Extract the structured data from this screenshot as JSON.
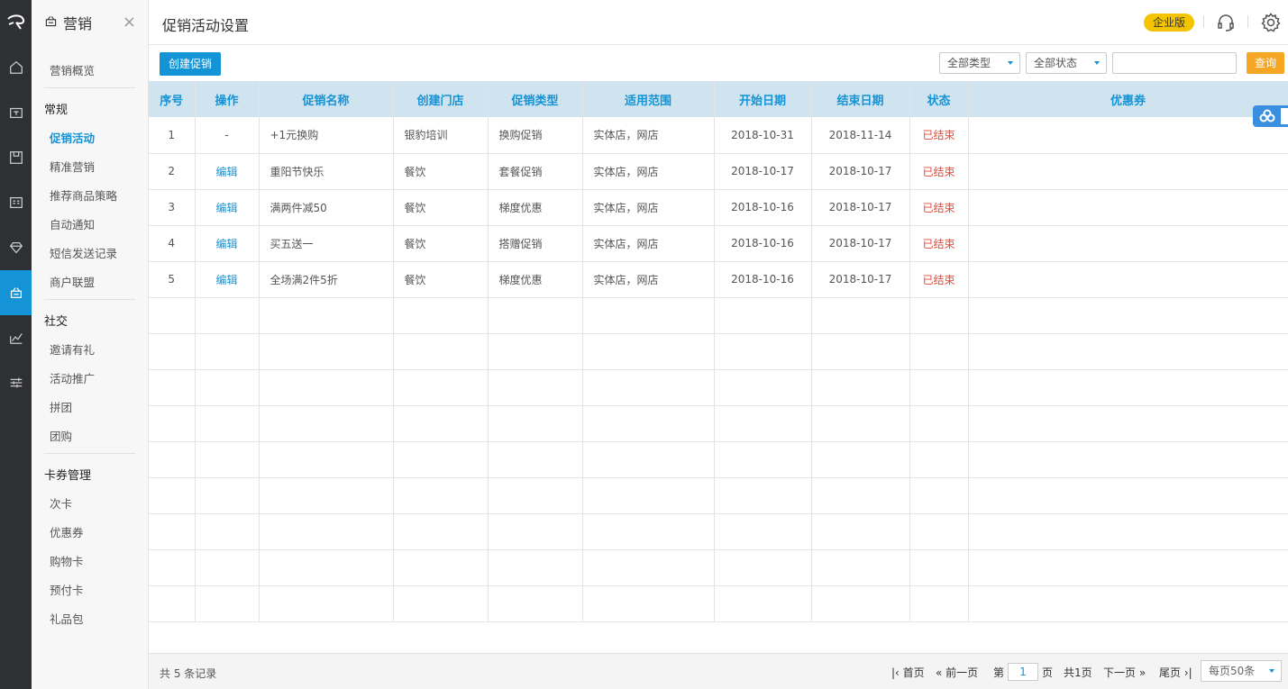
{
  "sidebar": {
    "module_title": "营销",
    "close_icon": "close-icon",
    "overview": "营销概览",
    "groups": [
      {
        "title": "常规",
        "items": [
          "促销活动",
          "精准营销",
          "推荐商品策略",
          "自动通知",
          "短信发送记录",
          "商户联盟"
        ]
      },
      {
        "title": "社交",
        "items": [
          "邀请有礼",
          "活动推广",
          "拼团",
          "团购"
        ]
      },
      {
        "title": "卡券管理",
        "items": [
          "次卡",
          "优惠券",
          "购物卡",
          "预付卡",
          "礼品包"
        ]
      }
    ],
    "active_item": "促销活动"
  },
  "rail": {
    "icons": [
      "logo-icon",
      "home-icon",
      "cashier-icon",
      "goods-icon",
      "member-card-icon",
      "diamond-icon",
      "marketing-icon",
      "report-icon",
      "settings-sliders-icon"
    ],
    "active": "marketing-icon"
  },
  "header": {
    "title": "促销活动设置",
    "edition_badge": "企业版",
    "icons": [
      "headset-icon",
      "gear-icon"
    ]
  },
  "toolbar": {
    "create_label": "创建促销",
    "type_filter": "全部类型",
    "status_filter": "全部状态",
    "search_value": "",
    "query_label": "查询"
  },
  "table": {
    "columns": [
      "序号",
      "操作",
      "促销名称",
      "创建门店",
      "促销类型",
      "适用范围",
      "开始日期",
      "结束日期",
      "状态",
      "优惠券"
    ],
    "rows": [
      {
        "no": "1",
        "op": "-",
        "name": "+1元换购",
        "store": "银豹培训",
        "type": "换购促销",
        "scope": "实体店，网店",
        "start": "2018-10-31",
        "end": "2018-11-14",
        "status": "已结束",
        "coupon": ""
      },
      {
        "no": "2",
        "op": "编辑",
        "name": "重阳节快乐",
        "store": "餐饮",
        "type": "套餐促销",
        "scope": "实体店，网店",
        "start": "2018-10-17",
        "end": "2018-10-17",
        "status": "已结束",
        "coupon": ""
      },
      {
        "no": "3",
        "op": "编辑",
        "name": "满两件减50",
        "store": "餐饮",
        "type": "梯度优惠",
        "scope": "实体店，网店",
        "start": "2018-10-16",
        "end": "2018-10-17",
        "status": "已结束",
        "coupon": ""
      },
      {
        "no": "4",
        "op": "编辑",
        "name": "买五送一",
        "store": "餐饮",
        "type": "搭赠促销",
        "scope": "实体店，网店",
        "start": "2018-10-16",
        "end": "2018-10-17",
        "status": "已结束",
        "coupon": ""
      },
      {
        "no": "5",
        "op": "编辑",
        "name": "全场满2件5折",
        "store": "餐饮",
        "type": "梯度优惠",
        "scope": "实体店，网店",
        "start": "2018-10-16",
        "end": "2018-10-17",
        "status": "已结束",
        "coupon": ""
      }
    ]
  },
  "footer": {
    "total": "共 5 条记录",
    "first": "首页",
    "prev": "前一页",
    "page_prefix": "第",
    "page_value": "1",
    "page_suffix": "页",
    "page_total": "共1页",
    "next": "下一页",
    "last": "尾页",
    "page_size": "每页50条"
  },
  "colors": {
    "primary": "#1593d7",
    "accent": "#f5a623",
    "ended": "#e64a3b",
    "badge": "#f5c400"
  }
}
